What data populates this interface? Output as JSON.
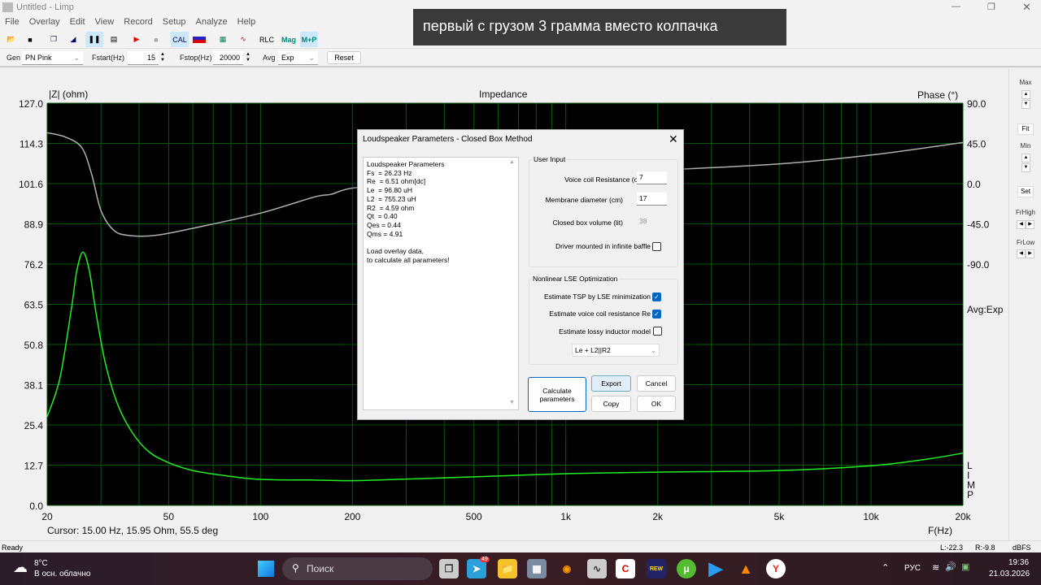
{
  "window": {
    "title": "Untitled - Limp"
  },
  "menu": [
    "File",
    "Overlay",
    "Edit",
    "View",
    "Record",
    "Setup",
    "Analyze",
    "Help"
  ],
  "toolbar": {
    "cal": "CAL",
    "rlc": "RLC",
    "mag": "Mag",
    "mp": "M+P"
  },
  "params": {
    "gen_label": "Gen",
    "gen_value": "PN Pink",
    "fstart_label": "Fstart(Hz)",
    "fstart_value": "15",
    "fstop_label": "Fstop(Hz)",
    "fstop_value": "20000",
    "avg_label": "Avg",
    "avg_value": "Exp",
    "reset": "Reset"
  },
  "banner": "первый с грузом 3 грамма вместо колпачка",
  "chart_data": {
    "type": "line",
    "title": "Impedance",
    "ylabel": "|Z| (ohm)",
    "y2label": "Phase (°)",
    "xlabel": "F(Hz)",
    "xscale": "log",
    "xlim": [
      20,
      20000
    ],
    "ylim": [
      0,
      127
    ],
    "y2lim": [
      -90,
      90
    ],
    "grid": true,
    "xticks": [
      "20",
      "50",
      "100",
      "200",
      "500",
      "1k",
      "2k",
      "5k",
      "10k",
      "20k"
    ],
    "yticks": [
      "127.0",
      "114.3",
      "101.6",
      "88.9",
      "76.2",
      "63.5",
      "50.8",
      "38.1",
      "25.4",
      "12.7",
      "0.0"
    ],
    "y2ticks": [
      "90.0",
      "45.0",
      "0.0",
      "-45.0",
      "-90.0"
    ],
    "series": [
      {
        "key": "impedance",
        "color": "#22ee22",
        "points": [
          [
            20,
            28
          ],
          [
            22,
            40
          ],
          [
            24,
            62
          ],
          [
            25,
            74
          ],
          [
            26.2,
            80
          ],
          [
            27.5,
            74
          ],
          [
            29,
            60
          ],
          [
            31,
            45
          ],
          [
            34,
            32
          ],
          [
            38,
            23
          ],
          [
            43,
            17
          ],
          [
            50,
            13.5
          ],
          [
            60,
            11
          ],
          [
            75,
            9.5
          ],
          [
            100,
            8.2
          ],
          [
            150,
            8
          ],
          [
            200,
            7.8
          ],
          [
            300,
            8.3
          ],
          [
            500,
            9
          ],
          [
            1000,
            10
          ],
          [
            2000,
            10.5
          ],
          [
            5000,
            11
          ],
          [
            10000,
            12.5
          ],
          [
            15000,
            14.5
          ],
          [
            20000,
            16.5
          ]
        ]
      },
      {
        "key": "phase",
        "color": "#b0b0b0",
        "axis": "y2",
        "points": [
          [
            20,
            57
          ],
          [
            23,
            52
          ],
          [
            26,
            40
          ],
          [
            28,
            10
          ],
          [
            30,
            -30
          ],
          [
            33,
            -52
          ],
          [
            37,
            -58
          ],
          [
            45,
            -58
          ],
          [
            60,
            -50
          ],
          [
            100,
            -33
          ],
          [
            150,
            -15
          ],
          [
            170,
            -12
          ],
          [
            200,
            -5
          ],
          [
            300,
            0
          ],
          [
            500,
            5
          ],
          [
            1000,
            10
          ],
          [
            2000,
            15
          ],
          [
            5000,
            22
          ],
          [
            10000,
            32
          ],
          [
            20000,
            46
          ]
        ]
      }
    ]
  },
  "avg_indicator": "Avg:Exp",
  "limp_label": "LIMP",
  "cursor": "Cursor: 15.00 Hz, 15.95 Ohm, 55.5 deg",
  "side": {
    "max": "Max",
    "fit": "Fit",
    "min": "Min",
    "set": "Set",
    "frhigh": "FrHigh",
    "frlow": "FrLow"
  },
  "status": {
    "ready": "Ready",
    "l": "L:-22.3",
    "r": "R:-9.8",
    "unit": "dBFS"
  },
  "dialog": {
    "title": "Loudspeaker Parameters - Closed Box Method",
    "results": "Loudspeaker Parameters\nFs  = 26.23 Hz\nRe  = 6.51 ohm[dc]\nLe  = 96.80 uH\nL2  = 755.23 uH\nR2  = 4.59 ohm\nQt  = 0.40\nQes = 0.44\nQms = 4.91\n\nLoad overlay data,\nto calculate all parameters!",
    "user_input": "User Input",
    "vc_label": "Voice coil Resistance (ohm)",
    "vc_value": "7",
    "md_label": "Membrane diameter (cm)",
    "md_value": "17",
    "cb_label": "Closed box volume (lit)",
    "cb_value": "38",
    "baffle_label": "Driver mounted in infinite baffle",
    "baffle_checked": false,
    "lse": "Nonlinear LSE Optimization",
    "tsp_label": "Estimate TSP by LSE minimization",
    "tsp_checked": true,
    "re_label": "Estimate voice coil resistance Re",
    "re_checked": true,
    "lossy_label": "Estimate lossy inductor model",
    "lossy_checked": false,
    "model": "Le + L2||R2",
    "calc": "Calculate parameters",
    "export": "Export",
    "cancel": "Cancel",
    "copy": "Copy",
    "ok": "OK"
  },
  "taskbar": {
    "temp": "8°C",
    "weather": "В осн. облачно",
    "search": "Поиск",
    "lang": "РУС",
    "time": "19:36",
    "date": "21.03.2026",
    "telegram_badge": "49"
  }
}
